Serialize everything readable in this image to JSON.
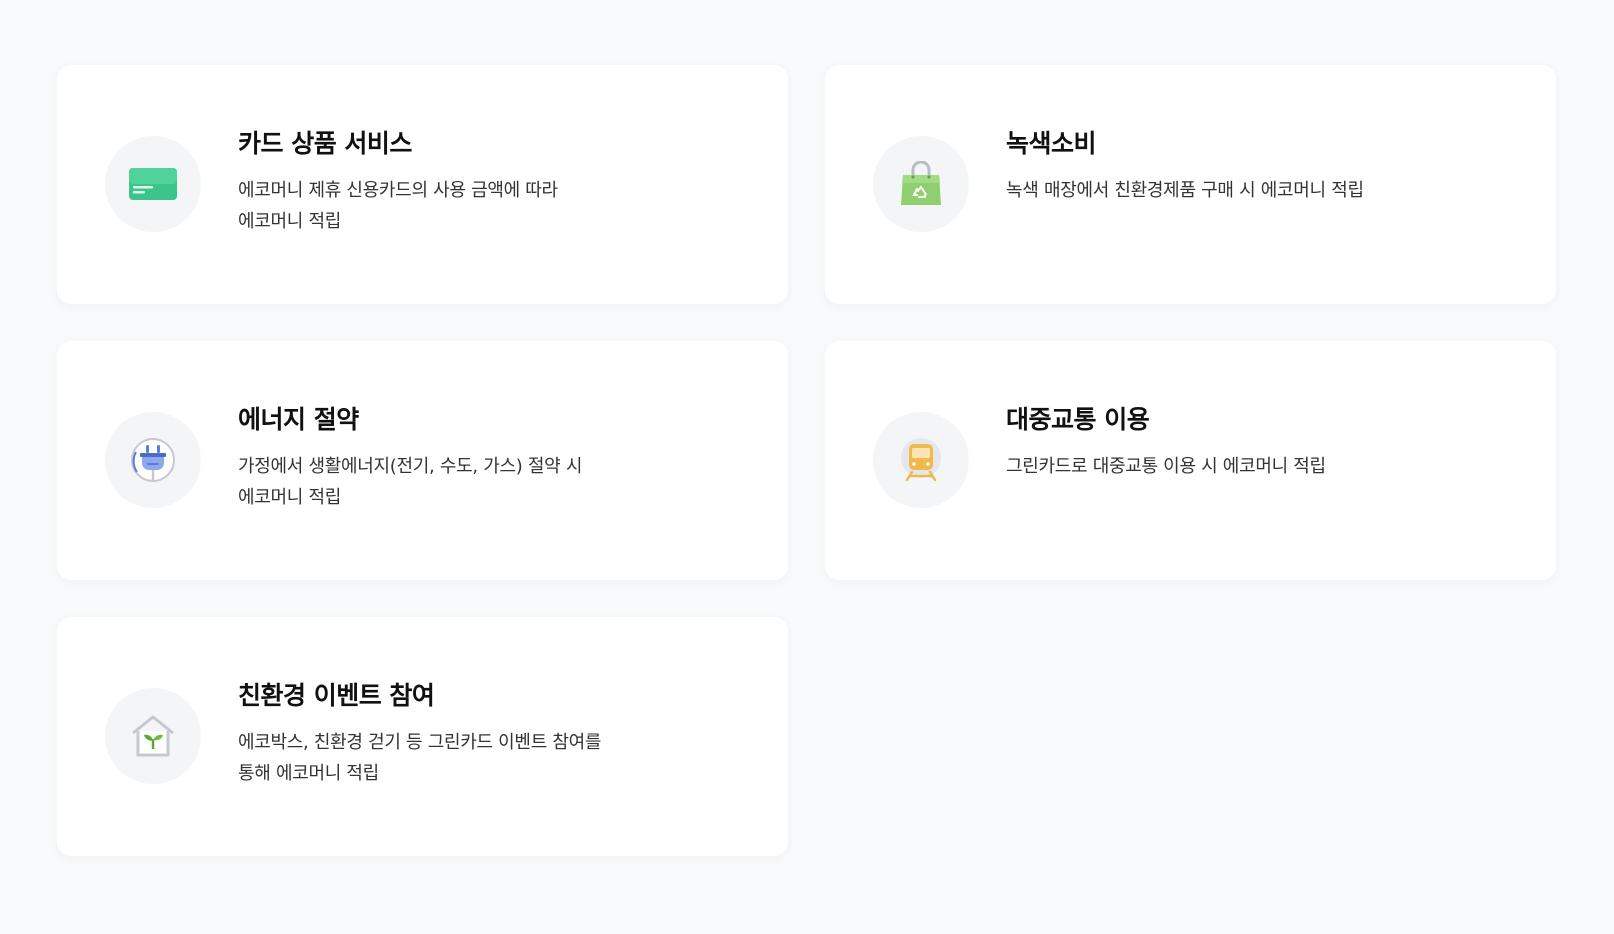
{
  "cards": [
    {
      "title": "카드 상품 서비스",
      "description": "에코머니 제휴 신용카드의 사용 금액에 따라\n에코머니 적립",
      "icon": "credit-card-icon",
      "icon_color": "#3cc48a"
    },
    {
      "title": "녹색소비",
      "description": "녹색 매장에서 친환경제품 구매 시 에코머니 적립",
      "icon": "shopping-bag-icon",
      "icon_color": "#8fcf6e"
    },
    {
      "title": "에너지 절약",
      "description": "가정에서 생활에너지(전기, 수도, 가스) 절약 시\n에코머니 적립",
      "icon": "plug-icon",
      "icon_color": "#5b7fd9"
    },
    {
      "title": "대중교통 이용",
      "description": "그린카드로 대중교통 이용 시 에코머니 적립",
      "icon": "train-icon",
      "icon_color": "#f0b94e"
    },
    {
      "title": "친환경 이벤트 참여",
      "description": "에코박스, 친환경 걷기 등 그린카드 이벤트 참여를\n통해 에코머니 적립",
      "icon": "sprout-house-icon",
      "icon_color": "#5aa83a"
    }
  ]
}
